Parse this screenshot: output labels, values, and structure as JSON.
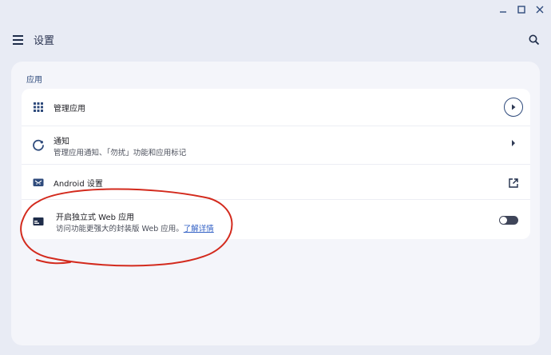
{
  "window": {
    "minimize_icon": "minimize-icon",
    "maximize_icon": "maximize-icon",
    "close_icon": "close-icon"
  },
  "appbar": {
    "title": "设置",
    "menu_icon": "menu-icon",
    "search_icon": "search-icon"
  },
  "section": {
    "label": "应用"
  },
  "rows": [
    {
      "title": "管理应用",
      "icon": "apps-grid-icon",
      "action_icon": "arrow-circle-icon"
    },
    {
      "title": "通知",
      "subtitle": "管理应用通知、「勿扰」功能和应用标记",
      "icon": "notification-icon",
      "action_icon": "chevron-right-icon"
    },
    {
      "title": "Android 设置",
      "icon": "android-icon",
      "action_icon": "open-external-icon"
    },
    {
      "title": "开启独立式 Web 应用",
      "subtitle": "访问功能更强大的封装版 Web 应用。",
      "link": "了解详情",
      "icon": "web-app-icon",
      "toggle_state": "off"
    }
  ],
  "colors": {
    "background": "#e8ebf4",
    "card": "#f4f5fa",
    "accent": "#2f4b7c",
    "link": "#2f5ec4",
    "annotation": "#d32a1d"
  }
}
